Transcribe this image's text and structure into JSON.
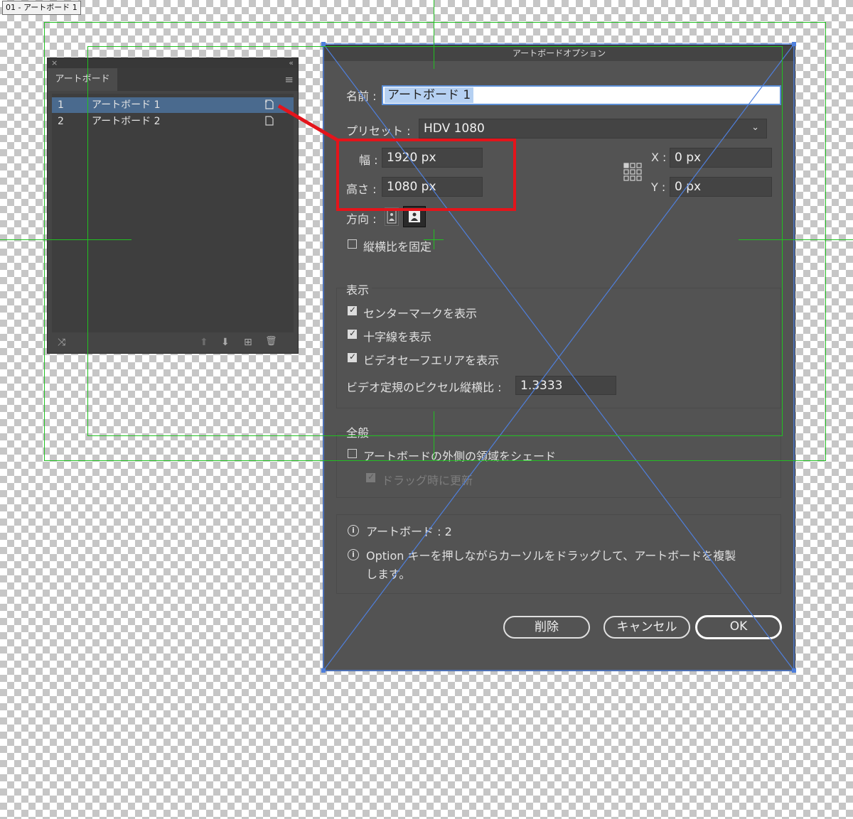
{
  "artboard_tag": "01 - アートボード 1",
  "panel": {
    "close_glyph": "×",
    "collapse_glyph": "«",
    "tab": "アートボード",
    "menu_glyph": "≡",
    "rows": [
      {
        "num": "1",
        "name": "アートボード 1"
      },
      {
        "num": "2",
        "name": "アートボード 2"
      }
    ],
    "footer": {
      "rearrange_glyph": "⤨",
      "up_glyph": "⬆",
      "down_glyph": "⬇",
      "new_glyph": "⊞",
      "delete_glyph": "🗑"
    }
  },
  "dialog": {
    "title": "アートボードオプション",
    "name_label": "名前 :",
    "name_value": "アートボード 1",
    "preset_label": "プリセット :",
    "preset_value": "HDV 1080",
    "width_label": "幅 :",
    "width_value": "1920 px",
    "height_label": "高さ :",
    "height_value": "1080 px",
    "x_label": "X :",
    "x_value": "0 px",
    "y_label": "Y :",
    "y_value": "0 px",
    "orientation_label": "方向 :",
    "aspect_lock_label": "縦横比を固定",
    "display_section": "表示",
    "show_center_mark": "センターマークを表示",
    "show_crosshairs": "十字線を表示",
    "show_video_safe": "ビデオセーフエリアを表示",
    "pixel_aspect_label": "ビデオ定規のピクセル縦横比 :",
    "pixel_aspect_value": "1.3333",
    "general_section": "全般",
    "fade_outside": "アートボードの外側の領域をシェード",
    "update_while_dragging": "ドラッグ時に更新",
    "info_artboards": "アートボード : 2",
    "info_option_line1": "Option キーを押しながらカーソルをドラッグして、アートボードを複製",
    "info_option_line2": "します。",
    "delete_button": "削除",
    "cancel_button": "キャンセル",
    "ok_button": "OK"
  },
  "colors": {
    "guide_green": "#21c021",
    "highlight_red": "#e4141b",
    "selection_blue": "#4a6a8e",
    "overlay_blue": "#4f7fdc"
  }
}
